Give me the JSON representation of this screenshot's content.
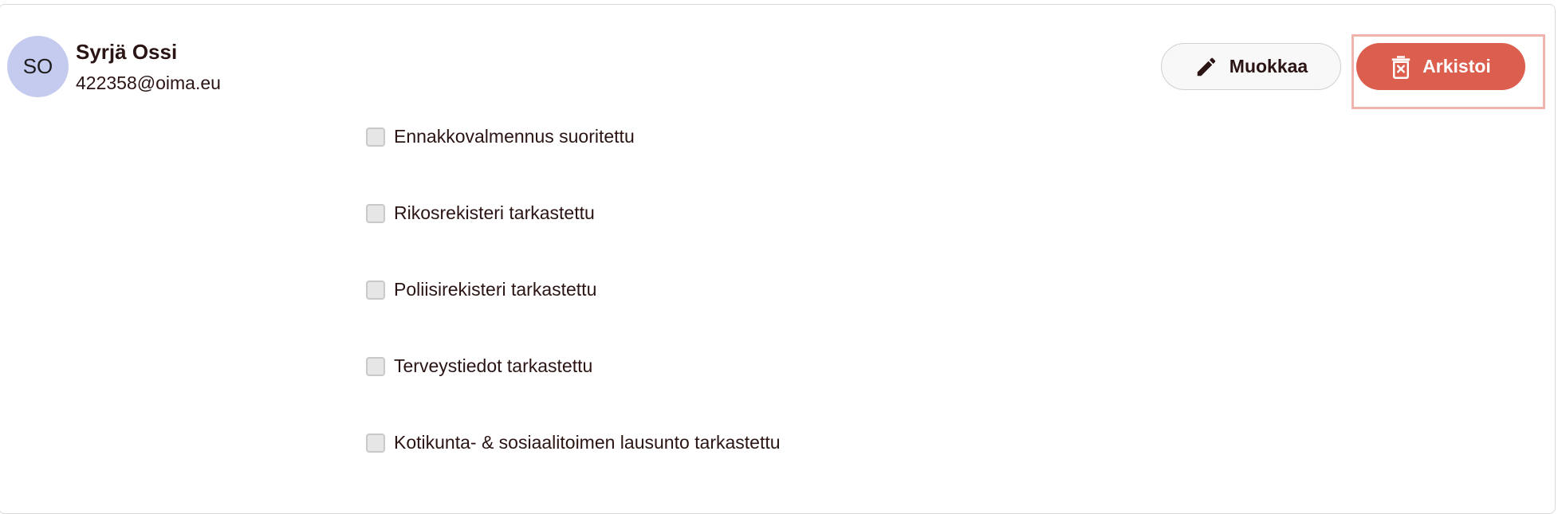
{
  "user": {
    "initials": "SO",
    "name": "Syrjä Ossi",
    "email": "422358@oima.eu"
  },
  "actions": {
    "edit_label": "Muokkaa",
    "archive_label": "Arkistoi"
  },
  "checklist": [
    {
      "label": "Ennakkovalmennus suoritettu",
      "checked": false
    },
    {
      "label": "Rikosrekisteri tarkastettu",
      "checked": false
    },
    {
      "label": "Poliisirekisteri tarkastettu",
      "checked": false
    },
    {
      "label": "Terveystiedot tarkastettu",
      "checked": false
    },
    {
      "label": "Kotikunta- & sosiaalitoimen lausunto tarkastettu",
      "checked": false
    }
  ],
  "colors": {
    "archive_button": "#db5e4e",
    "avatar_bg": "#c5cbef",
    "highlight": "#f0b3ad"
  },
  "icons": {
    "edit": "pencil-icon",
    "archive": "trash-x-icon"
  }
}
